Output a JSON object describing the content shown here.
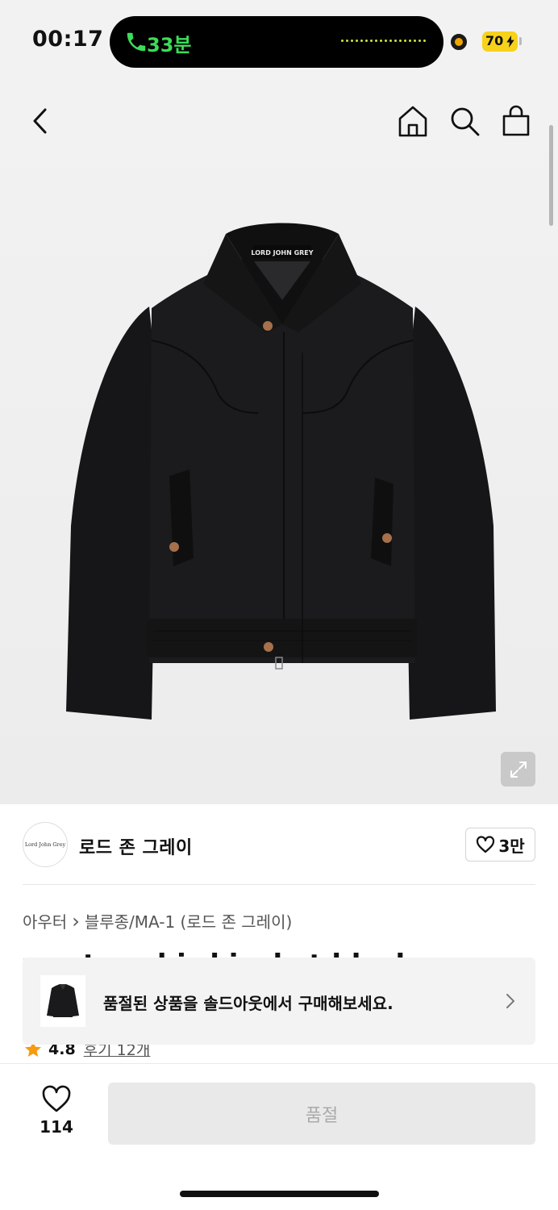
{
  "status_bar": {
    "time": "00:17",
    "call_duration": "33분",
    "battery": "70"
  },
  "colors": {
    "call_green": "#3ddc59",
    "battery_yellow": "#f6d21b",
    "star": "#f79a0f"
  },
  "nav": {
    "back_icon": "chevron-left-icon",
    "home_icon": "home-icon",
    "search_icon": "search-icon",
    "cart_icon": "shopping-bag-icon"
  },
  "product_image": {
    "label_text": "LORD JOHN GREY"
  },
  "brand": {
    "logo_text": "Lord John Grey",
    "name": "로드 존 그레이",
    "like_count": "3만"
  },
  "breadcrumb": {
    "category": "아우터",
    "separator": "›",
    "subcategory": "블루종/MA-1 (로드 존 그레이)"
  },
  "product": {
    "title_peek": "western bird jacket black"
  },
  "rating": {
    "score": "4.8",
    "review_link": "후기 12개"
  },
  "soldout_banner": {
    "text": "품절된 상품을 솔드아웃에서 구매해보세요."
  },
  "bottom_bar": {
    "wish_count": "114",
    "buy_button_label": "품절"
  }
}
